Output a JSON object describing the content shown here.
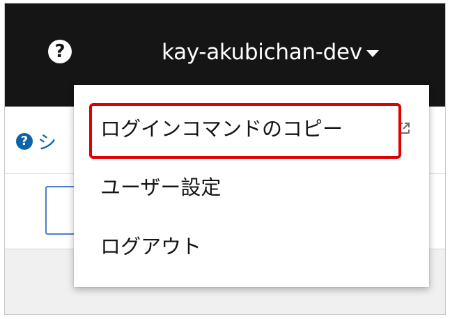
{
  "masthead": {
    "help_icon": "question-circle-icon",
    "help_glyph": "?",
    "username": "kay-akubichan-dev",
    "caret_icon": "caret-down-icon",
    "background": "#151515"
  },
  "content": {
    "help_icon": "question-circle-icon",
    "help_glyph": "?",
    "link_text_partial": "シ",
    "link_color": "#0b64a8"
  },
  "user_menu": {
    "items": [
      {
        "label": "ログインコマンドのコピー",
        "icon": "external-link-icon",
        "highlighted": true
      },
      {
        "label": "ユーザー設定"
      },
      {
        "label": "ログアウト"
      }
    ]
  },
  "highlight": {
    "color": "#e00000"
  }
}
